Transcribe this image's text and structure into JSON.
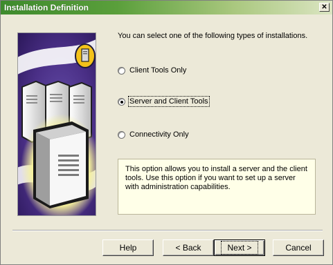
{
  "window": {
    "title": "Installation Definition"
  },
  "intro_text": "You can select one of the following types of installations.",
  "options": [
    {
      "label": "Client Tools Only",
      "checked": false
    },
    {
      "label": "Server and Client Tools",
      "checked": true
    },
    {
      "label": "Connectivity Only",
      "checked": false
    }
  ],
  "description": "This option allows you to install a server and the client tools. Use this option if you want to set up a server with administration capabilities.",
  "buttons": {
    "help": "Help",
    "back": "< Back",
    "next": "Next >",
    "cancel": "Cancel"
  },
  "colors": {
    "title_gradient_start": "#3e8b2d",
    "art_background": "#4a2f86",
    "glow": "#f6f29a"
  },
  "icons": {
    "close": "close-icon",
    "badge": "server-badge-icon",
    "illustration": "server-tower-illustration"
  }
}
